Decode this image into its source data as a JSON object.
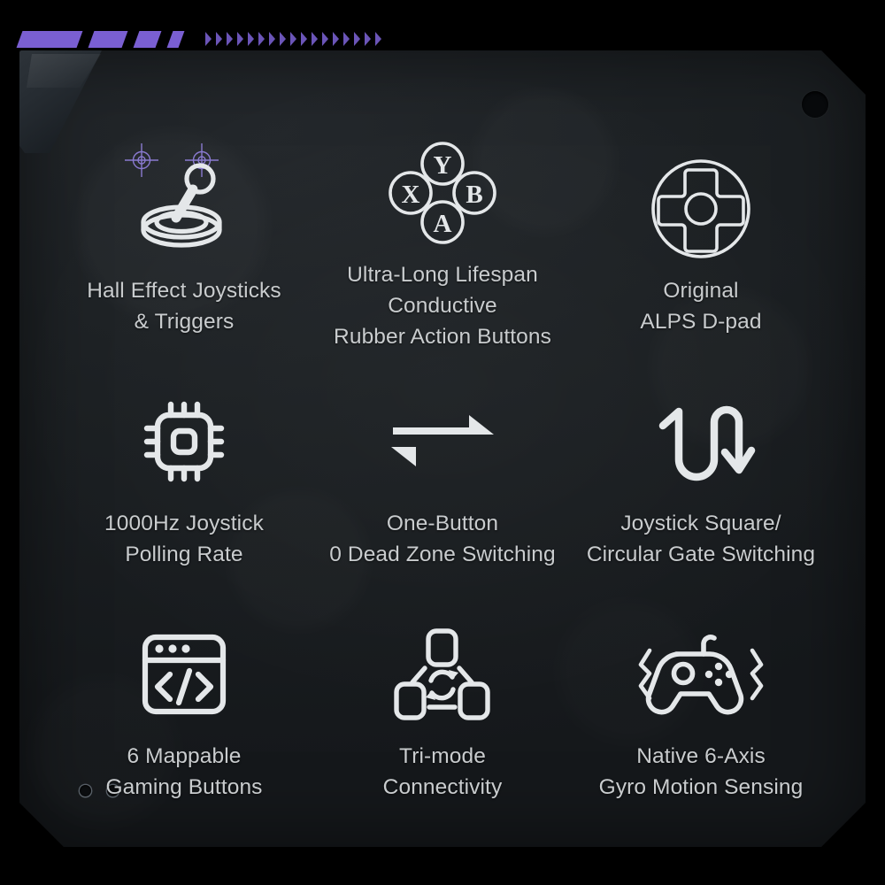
{
  "header": {
    "bars": [
      "bar-wide",
      "bar-medium",
      "bar-small",
      "bar-tiny"
    ],
    "chevron_count": 17,
    "accent_color": "#7a5fd2",
    "chevron_color": "#6b55b8"
  },
  "panel": {
    "background_color": "#1c2023",
    "corner_hole": "mounting-hole",
    "flap_label": "corner-tab",
    "reticles": [
      "crosshair-reticle-1",
      "crosshair-reticle-2"
    ],
    "reticle_color": "#8a7ad0",
    "micro_dots": [
      "indicator-dot-1",
      "indicator-dot-2"
    ]
  },
  "features": [
    {
      "id": "hall-effect-joysticks",
      "icon": "joystick-icon",
      "line1": "Hall Effect Joysticks",
      "line2": "& Triggers",
      "label": "Hall Effect Joysticks\n& Triggers"
    },
    {
      "id": "conductive-rubber-buttons",
      "icon": "abxy-buttons-icon",
      "line1": "Ultra-Long Lifespan Conductive",
      "line2": "Rubber Action Buttons",
      "label": "Ultra-Long Lifespan Conductive\nRubber Action Buttons",
      "buttons": [
        "Y",
        "X",
        "B",
        "A"
      ]
    },
    {
      "id": "alps-dpad",
      "icon": "dpad-icon",
      "line1": "Original",
      "line2": "ALPS D-pad",
      "label": "Original\nALPS D-pad"
    },
    {
      "id": "polling-rate",
      "icon": "cpu-chip-icon",
      "line1": "1000Hz Joystick",
      "line2": "Polling Rate",
      "label": "1000Hz Joystick\nPolling Rate"
    },
    {
      "id": "dead-zone-switching",
      "icon": "swap-arrows-icon",
      "line1": "One-Button",
      "line2": "0 Dead Zone Switching",
      "label": "One-Button\n0 Dead Zone Switching"
    },
    {
      "id": "gate-switching",
      "icon": "serpentine-switch-icon",
      "line1": "Joystick Square/",
      "line2": "Circular Gate Switching",
      "label": "Joystick Square/\nCircular Gate Switching"
    },
    {
      "id": "mappable-buttons",
      "icon": "code-window-icon",
      "line1": "6 Mappable",
      "line2": "Gaming Buttons",
      "label": "6 Mappable\nGaming Buttons"
    },
    {
      "id": "tri-mode-connectivity",
      "icon": "tri-mode-sync-icon",
      "line1": "Tri-mode",
      "line2": "Connectivity",
      "label": "Tri-mode\nConnectivity"
    },
    {
      "id": "gyro-motion-sensing",
      "icon": "gamepad-gyro-icon",
      "line1": "Native 6-Axis",
      "line2": "Gyro Motion Sensing",
      "label": "Native 6-Axis\nGyro Motion Sensing"
    }
  ],
  "style": {
    "label_color": "#c9ccce",
    "icon_color": "#e4e7e9"
  }
}
